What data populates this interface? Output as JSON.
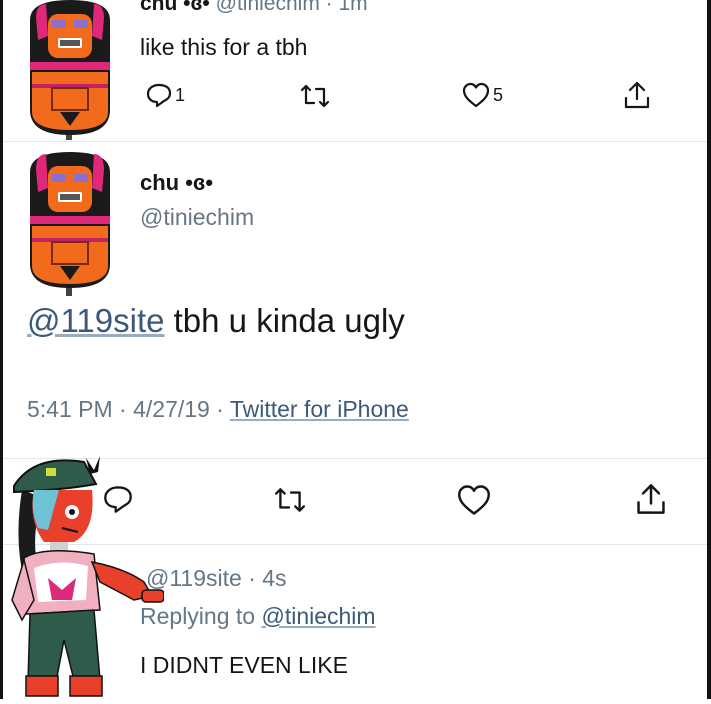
{
  "tweet_top": {
    "display_name": "chu •ɞ•",
    "handle_time": "@tiniechim · 1m",
    "text": "like this for a tbh",
    "reply_count": "1",
    "like_count": "5"
  },
  "main_tweet": {
    "display_name": "chu •ɞ•",
    "handle": "@tiniechim",
    "mention": "@119site",
    "text": " tbh u kinda ugly",
    "time": "5:41 PM · 4/27/19 · ",
    "source": "Twitter for iPhone"
  },
  "reply": {
    "handle_time": "@119site · 4s",
    "replying_prefix": "Replying to ",
    "replying_to": "@tiniechim",
    "text": "I DIDNT EVEN LIKE"
  },
  "colors": {
    "avatar_red": "#e8402a",
    "avatar_pink": "#e0287a",
    "avatar_orange": "#f26a1b",
    "icon_gray": "#14171a",
    "link": "#3b5a7a"
  }
}
